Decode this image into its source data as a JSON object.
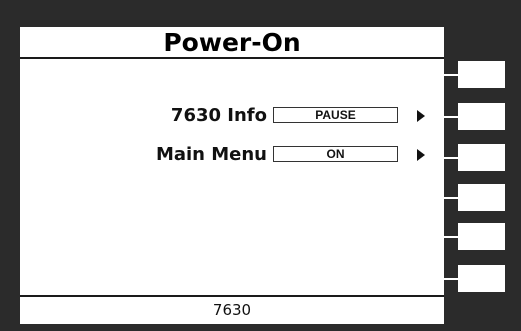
{
  "screen": {
    "title": "Power-On",
    "footer": "7630"
  },
  "menu": {
    "items": [
      {
        "label": "7630 Info",
        "value": "PAUSE"
      },
      {
        "label": "Main Menu",
        "value": "ON"
      }
    ]
  },
  "colors": {
    "bezel": "#2b2b2b",
    "screen": "#ffffff",
    "text": "#111111"
  },
  "icons": {
    "row_arrow": "triangle-right-icon"
  }
}
